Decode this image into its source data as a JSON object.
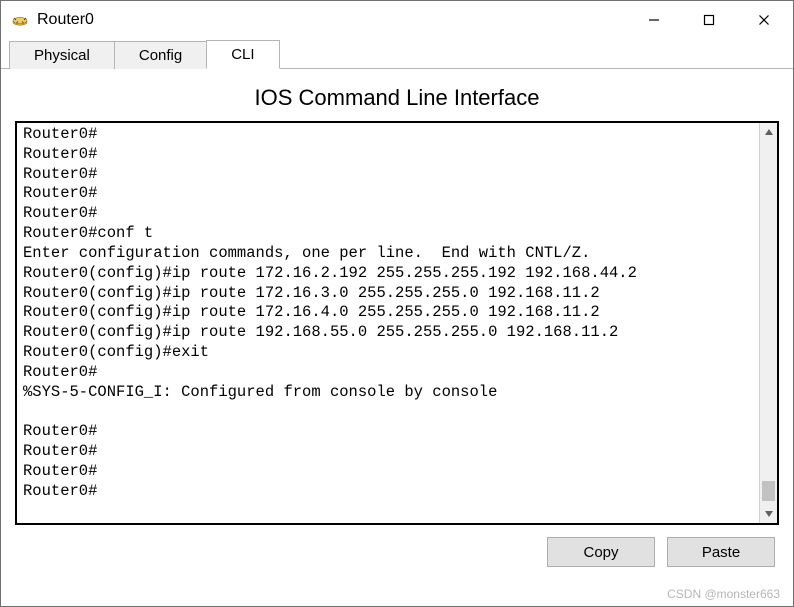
{
  "window": {
    "title": "Router0"
  },
  "tabs": {
    "items": [
      {
        "label": "Physical",
        "active": false
      },
      {
        "label": "Config",
        "active": false
      },
      {
        "label": "CLI",
        "active": true
      }
    ]
  },
  "cli": {
    "heading": "IOS Command Line Interface",
    "lines": [
      "Router0#",
      "Router0#",
      "Router0#",
      "Router0#",
      "Router0#",
      "Router0#conf t",
      "Enter configuration commands, one per line.  End with CNTL/Z.",
      "Router0(config)#ip route 172.16.2.192 255.255.255.192 192.168.44.2",
      "Router0(config)#ip route 172.16.3.0 255.255.255.0 192.168.11.2",
      "Router0(config)#ip route 172.16.4.0 255.255.255.0 192.168.11.2",
      "Router0(config)#ip route 192.168.55.0 255.255.255.0 192.168.11.2",
      "Router0(config)#exit",
      "Router0#",
      "%SYS-5-CONFIG_I: Configured from console by console",
      "",
      "Router0#",
      "Router0#",
      "Router0#",
      "Router0#"
    ]
  },
  "buttons": {
    "copy": "Copy",
    "paste": "Paste"
  },
  "watermark": "CSDN @monster663"
}
